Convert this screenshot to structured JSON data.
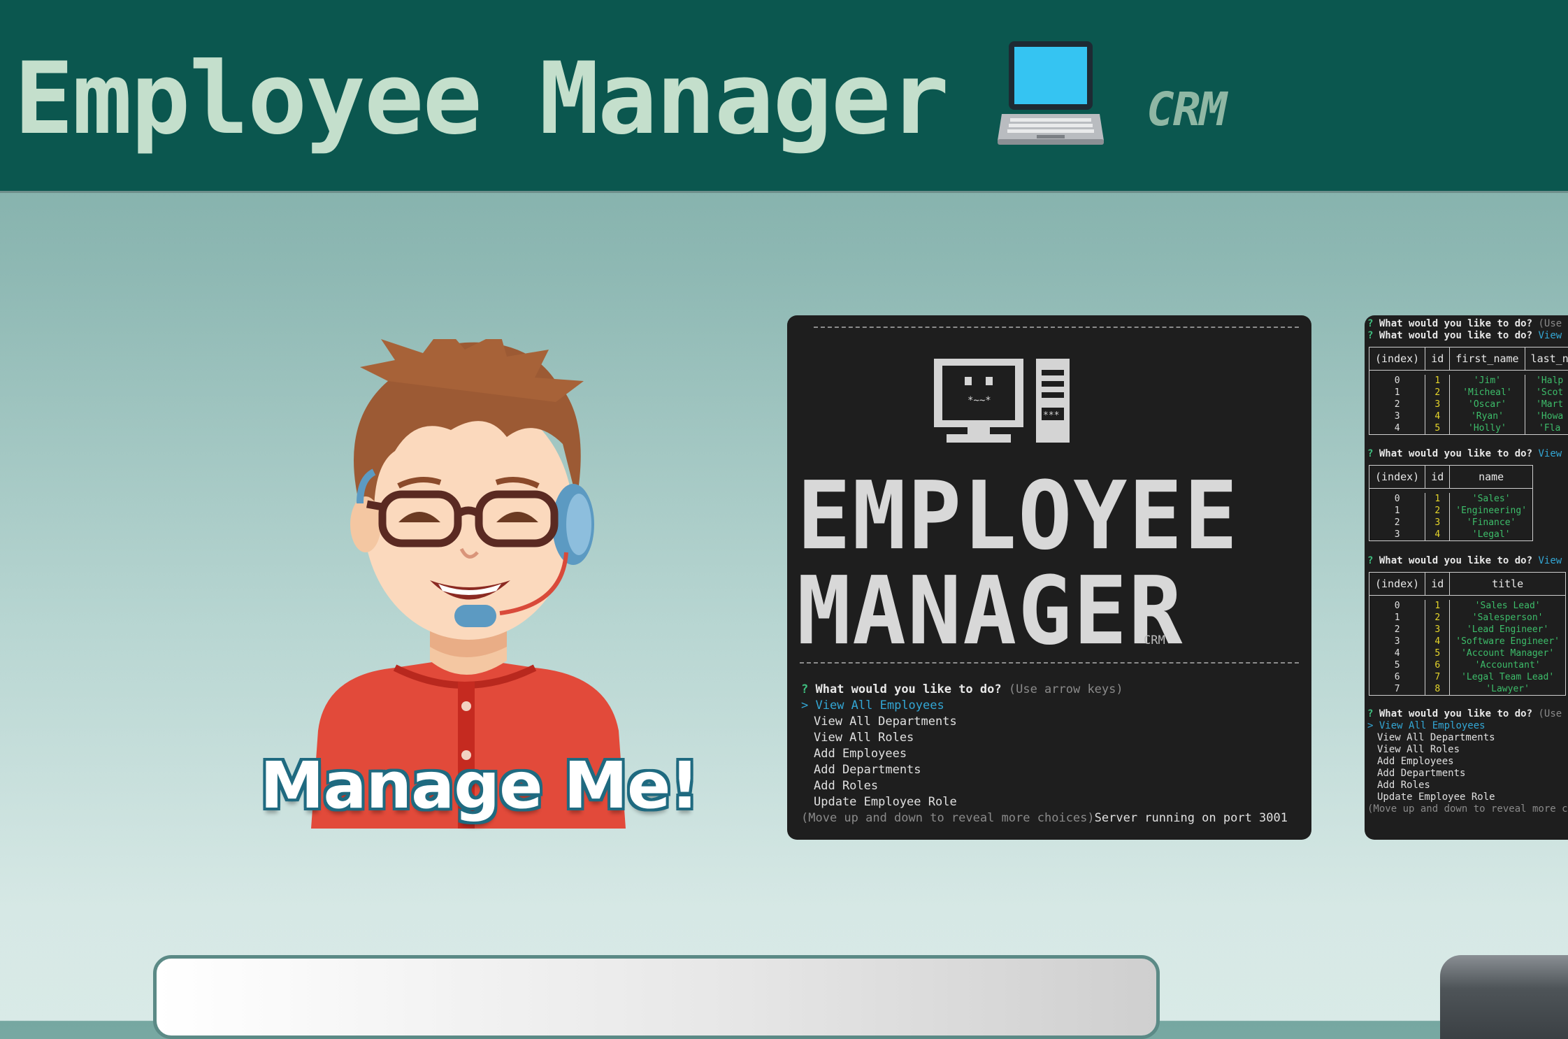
{
  "header": {
    "title": "Employee Manager",
    "laptop_icon": "laptop-icon",
    "tag": "CRM"
  },
  "hero": {
    "mascot_caption": "Manage Me!"
  },
  "terminal_main": {
    "ascii_word_1": "EMPLOYEE",
    "ascii_word_2": "MANAGER",
    "crm_label": "CRM",
    "question_mark": "?",
    "question": "What would you like to do?",
    "hint": "(Use arrow keys)",
    "pointer": ">",
    "options": [
      "View All Employees",
      "View All Departments",
      "View All Roles",
      "Add Employees",
      "Add Departments",
      "Add Roles",
      "Update Employee Role"
    ],
    "footer_hint": "(Move up and down to reveal more choices)",
    "footer_status": "Server running on port 3001"
  },
  "terminal_side": {
    "q1_hint": "(Use ar",
    "q1_answer": "View Al",
    "employees_table": {
      "headers": [
        "(index)",
        "id",
        "first_name",
        "last_n"
      ],
      "index": [
        "0",
        "1",
        "2",
        "3",
        "4"
      ],
      "id": [
        "1",
        "2",
        "3",
        "4",
        "5"
      ],
      "first_name": [
        "'Jim'",
        "'Micheal'",
        "'Oscar'",
        "'Ryan'",
        "'Holly'"
      ],
      "last_name": [
        "'Halp",
        "'Scot",
        "'Mart",
        "'Howa",
        "'Fla"
      ]
    },
    "q2_answer": "View Al",
    "departments_table": {
      "headers": [
        "(index)",
        "id",
        "name"
      ],
      "index": [
        "0",
        "1",
        "2",
        "3"
      ],
      "id": [
        "1",
        "2",
        "3",
        "4"
      ],
      "name": [
        "'Sales'",
        "'Engineering'",
        "'Finance'",
        "'Legal'"
      ]
    },
    "q3_answer": "View Al",
    "roles_table": {
      "headers": [
        "(index)",
        "id",
        "title"
      ],
      "index": [
        "0",
        "1",
        "2",
        "3",
        "4",
        "5",
        "6",
        "7"
      ],
      "id": [
        "1",
        "2",
        "3",
        "4",
        "5",
        "6",
        "7",
        "8"
      ],
      "title": [
        "'Sales Lead'",
        "'Salesperson'",
        "'Lead Engineer'",
        "'Software Engineer'",
        "'Account Manager'",
        "'Accountant'",
        "'Legal Team Lead'",
        "'Lawyer'"
      ]
    },
    "q4_hint": "(Use ar",
    "options": [
      "View All Employees",
      "View All Departments",
      "View All Roles",
      "Add Employees",
      "Add Departments",
      "Add Roles",
      "Update Employee Role"
    ],
    "footer_hint": "(Move up and down to reveal more cho"
  },
  "colors": {
    "header_bg": "#0b574f",
    "title_text": "#c4dfcc",
    "terminal_bg": "#1e1e1e",
    "terminal_green": "#3dbd6a",
    "terminal_cyan": "#33a6d4",
    "terminal_yellow": "#e6d62a"
  }
}
